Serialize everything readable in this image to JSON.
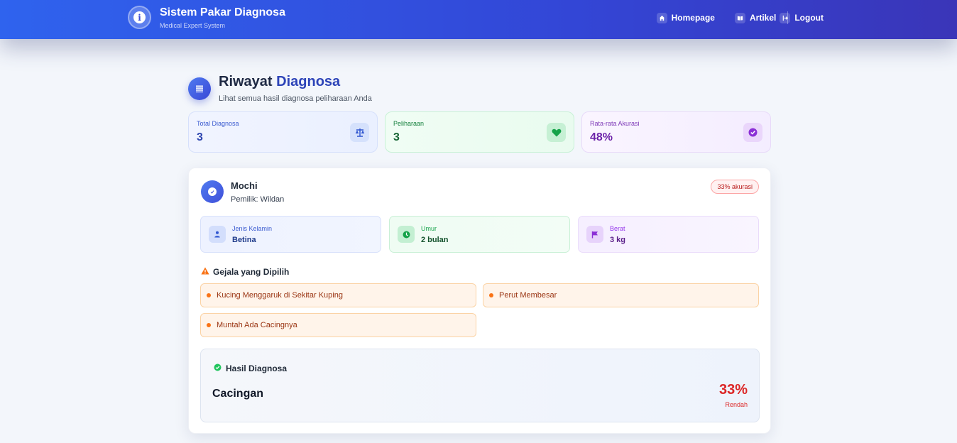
{
  "header": {
    "brand_title": "Sistem Pakar Diagnosa",
    "brand_subtitle": "Medical Expert System",
    "brand_icon": "info-icon",
    "nav": [
      {
        "label": "Homepage",
        "icon": "home-icon"
      },
      {
        "label": "Artikel",
        "icon": "book-icon"
      },
      {
        "label": "Logout",
        "icon": "logout-icon"
      }
    ]
  },
  "page": {
    "title_part1": "Riwayat",
    "title_part2": "Diagnosa",
    "subtitle": "Lihat semua hasil diagnosa peliharaan Anda",
    "icon": "list-icon"
  },
  "stats": [
    {
      "label": "Total Diagnosa",
      "value": "3",
      "icon": "scale-icon",
      "color": "#2e46b0"
    },
    {
      "label": "Peliharaan",
      "value": "3",
      "icon": "heart-icon",
      "color": "#16a34a"
    },
    {
      "label": "Rata-rata Akurasi",
      "value": "48%",
      "icon": "check-circle-icon",
      "color": "#7e22ce"
    }
  ],
  "record": {
    "pet_name": "Mochi",
    "owner": "Pemilik: Wildan",
    "accuracy_badge": "33% akurasi",
    "info": [
      {
        "label": "Jenis Kelamin",
        "value": "Betina",
        "icon": "person-icon"
      },
      {
        "label": "Umur",
        "value": "2 bulan",
        "icon": "clock-icon"
      },
      {
        "label": "Berat",
        "value": "3 kg",
        "icon": "flag-icon"
      }
    ],
    "symptoms_title": "Gejala yang Dipilih",
    "symptoms": [
      "Kucing Menggaruk di Sekitar Kuping",
      "Perut Membesar",
      "Muntah Ada Cacingnya"
    ],
    "result": {
      "heading": "Hasil Diagnosa",
      "disease": "Cacingan",
      "percent": "33%",
      "level": "Rendah",
      "color": "#dc2626"
    }
  }
}
